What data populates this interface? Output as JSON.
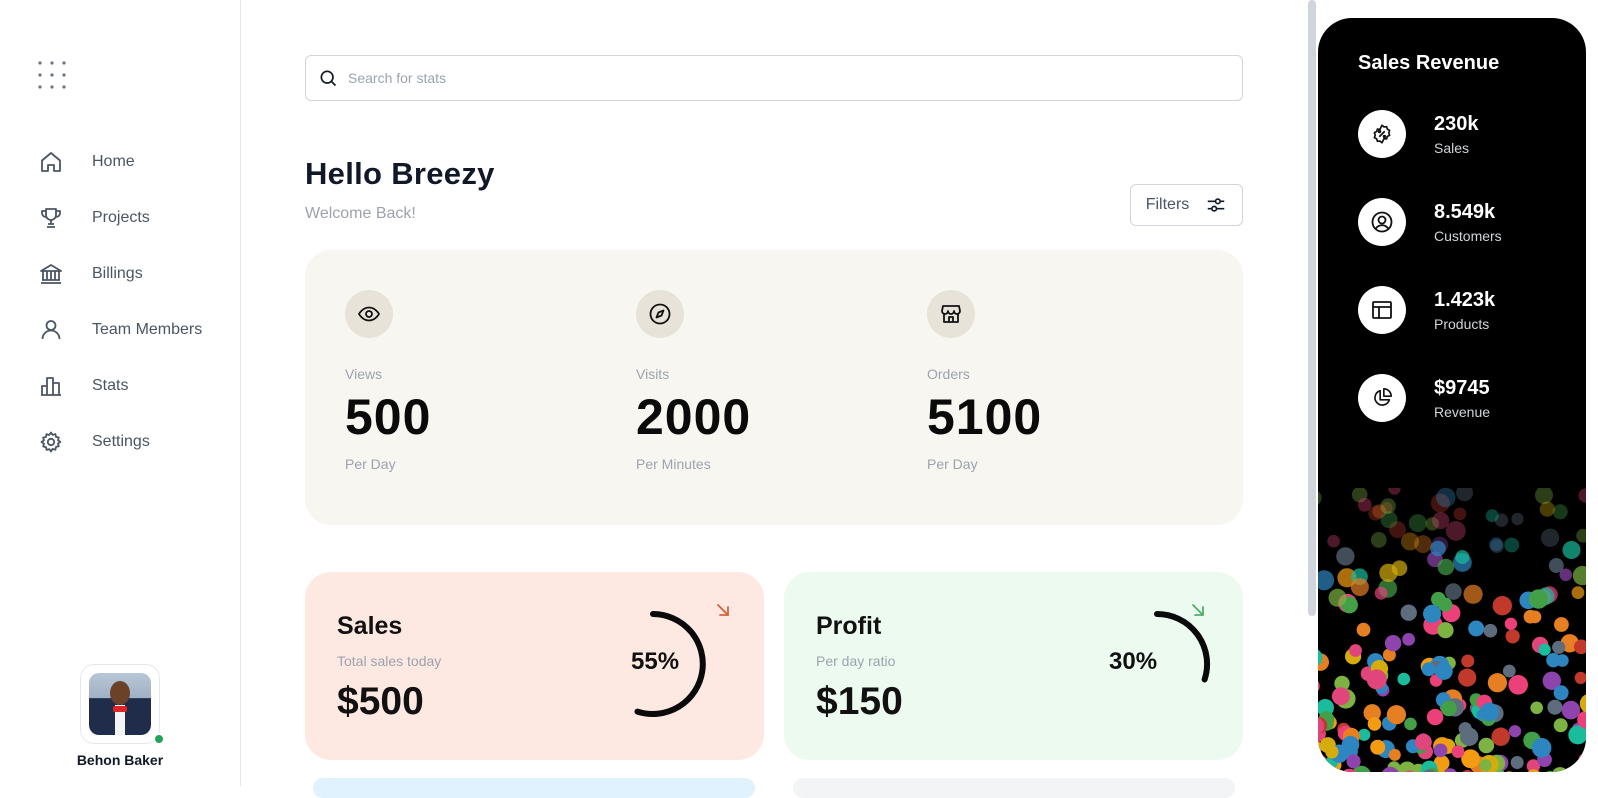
{
  "sidebar": {
    "items": [
      {
        "label": "Home",
        "icon": "home-icon"
      },
      {
        "label": "Projects",
        "icon": "trophy-icon"
      },
      {
        "label": "Billings",
        "icon": "bank-icon"
      },
      {
        "label": "Team Members",
        "icon": "user-icon"
      },
      {
        "label": "Stats",
        "icon": "bar-chart-icon"
      },
      {
        "label": "Settings",
        "icon": "gear-icon"
      }
    ],
    "profile": {
      "name": "Behon Baker",
      "status": "online"
    }
  },
  "search": {
    "placeholder": "Search for stats",
    "value": ""
  },
  "header": {
    "greeting": "Hello Breezy",
    "welcome": "Welcome Back!",
    "filters_label": "Filters"
  },
  "stats": [
    {
      "label": "Views",
      "value": "500",
      "unit": "Per Day",
      "icon": "eye-icon"
    },
    {
      "label": "Visits",
      "value": "2000",
      "unit": "Per Minutes",
      "icon": "compass-icon"
    },
    {
      "label": "Orders",
      "value": "5100",
      "unit": "Per Day",
      "icon": "store-icon"
    }
  ],
  "cards": {
    "sales": {
      "title": "Sales",
      "subtitle": "Total sales today",
      "amount": "$500",
      "percent_label": "55%",
      "percent": 55,
      "color": "#fde9e2",
      "arrow_color": "#d9603b"
    },
    "profit": {
      "title": "Profit",
      "subtitle": "Per day ratio",
      "amount": "$150",
      "percent_label": "30%",
      "percent": 30,
      "color": "#edfaf0",
      "arrow_color": "#4caf6a"
    }
  },
  "panel": {
    "title": "Sales Revenue",
    "items": [
      {
        "value": "230k",
        "label": "Sales",
        "icon": "discount-badge-icon"
      },
      {
        "value": "8.549k",
        "label": "Customers",
        "icon": "user-circle-icon"
      },
      {
        "value": "1.423k",
        "label": "Products",
        "icon": "layout-icon"
      },
      {
        "value": "$9745",
        "label": "Revenue",
        "icon": "pie-chart-icon"
      }
    ]
  }
}
